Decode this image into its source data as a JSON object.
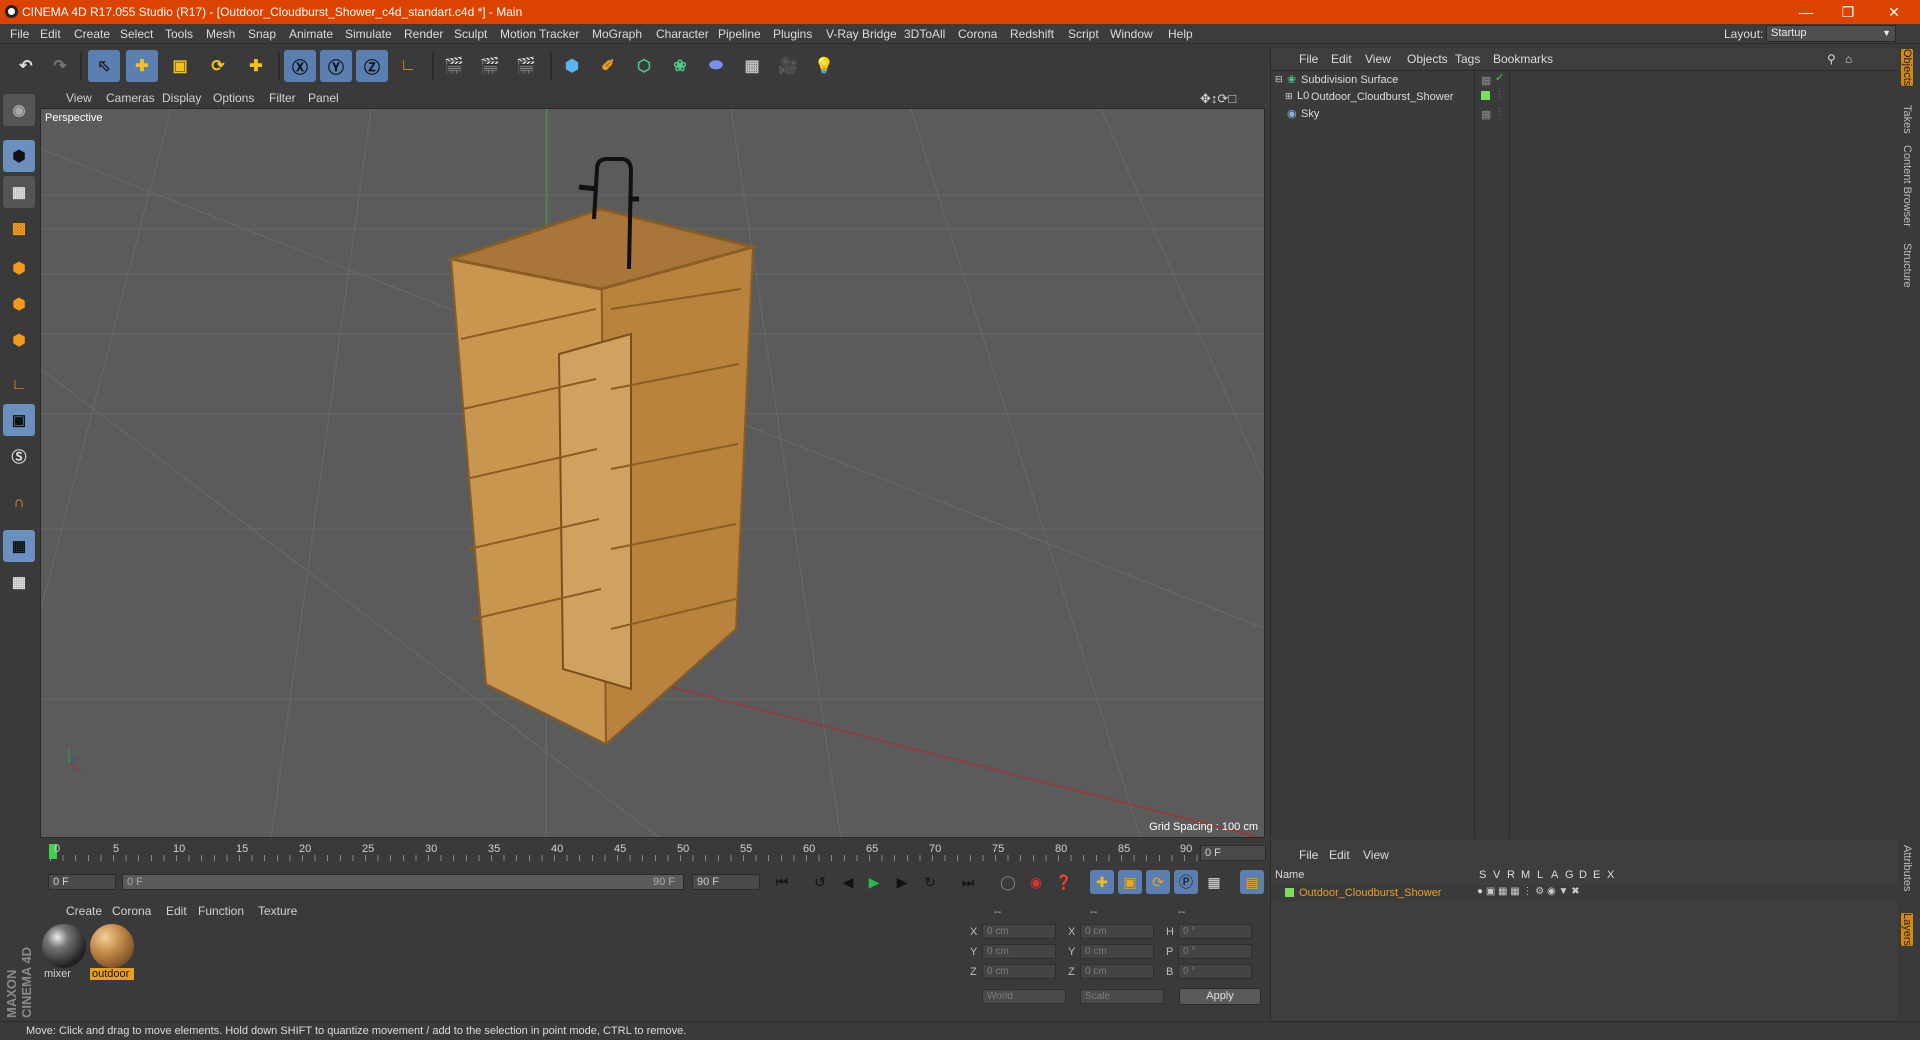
{
  "window": {
    "title": "CINEMA 4D R17.055 Studio (R17) - [Outdoor_Cloudburst_Shower_c4d_standart.c4d *] - Main"
  },
  "menu": [
    "File",
    "Edit",
    "Create",
    "Select",
    "Tools",
    "Mesh",
    "Snap",
    "Animate",
    "Simulate",
    "Render",
    "Sculpt",
    "Motion Tracker",
    "MoGraph",
    "Character",
    "Pipeline",
    "Plugins",
    "V-Ray Bridge",
    "3DToAll",
    "Corona",
    "Redshift",
    "Script",
    "Window",
    "Help"
  ],
  "layout": {
    "label": "Layout:",
    "value": "Startup"
  },
  "toolbar_icons": [
    "undo-icon",
    "redo-icon",
    "select-arrow-icon",
    "move-icon",
    "scale-icon",
    "rotate-icon",
    "add-icon",
    "x-axis-icon",
    "y-axis-icon",
    "z-axis-icon",
    "world-coordinate-icon",
    "render-view-icon",
    "render-region-icon",
    "render-manager-icon",
    "cube-icon",
    "pen-icon",
    "subdivision-icon",
    "cloner-icon",
    "deformer-icon",
    "floor-icon",
    "camera-icon",
    "light-icon"
  ],
  "viewport": {
    "menu": [
      "View",
      "Cameras",
      "Display",
      "Options",
      "Filter",
      "Panel"
    ],
    "label": "Perspective",
    "grid_spacing": "Grid Spacing : 100 cm"
  },
  "timeline": {
    "ticks": [
      "0",
      "5",
      "10",
      "15",
      "20",
      "25",
      "30",
      "35",
      "40",
      "45",
      "50",
      "55",
      "60",
      "65",
      "70",
      "75",
      "80",
      "85",
      "90"
    ],
    "frame_value": "0 F",
    "start_field": "0 F",
    "slider_left": "0 F",
    "slider_right": "90 F",
    "end_field": "90 F"
  },
  "materials": {
    "menu": [
      "Create",
      "Corona",
      "Edit",
      "Function",
      "Texture"
    ],
    "items": [
      {
        "name": "mixer"
      },
      {
        "name": "outdoor"
      }
    ]
  },
  "coords": {
    "header": [
      "--",
      "--",
      "--"
    ],
    "rows": [
      {
        "a": "X",
        "av": "0 cm",
        "b": "X",
        "bv": "0 cm",
        "c": "H",
        "cv": "0 °"
      },
      {
        "a": "Y",
        "av": "0 cm",
        "b": "Y",
        "bv": "0 cm",
        "c": "P",
        "cv": "0 °"
      },
      {
        "a": "Z",
        "av": "0 cm",
        "b": "Z",
        "bv": "0 cm",
        "c": "B",
        "cv": "0 °"
      }
    ],
    "world": "World",
    "scale": "Scale",
    "apply": "Apply"
  },
  "objects": {
    "menu": [
      "File",
      "Edit",
      "View",
      "Objects",
      "Tags",
      "Bookmarks"
    ],
    "items": [
      {
        "name": "Subdivision Surface"
      },
      {
        "name": "Outdoor_Cloudburst_Shower"
      },
      {
        "name": "Sky"
      }
    ]
  },
  "layers": {
    "menu": [
      "File",
      "Edit",
      "View"
    ],
    "header_name": "Name",
    "columns": [
      "S",
      "V",
      "R",
      "M",
      "L",
      "A",
      "G",
      "D",
      "E",
      "X"
    ],
    "item": "Outdoor_Cloudburst_Shower"
  },
  "right_tabs": [
    "Objects",
    "Takes",
    "Content Browser",
    "Structure",
    "Attributes",
    "Layers"
  ],
  "status": "Move: Click and drag to move elements. Hold down SHIFT to quantize movement / add to the selection in point mode, CTRL to remove.",
  "colors": {
    "accent": "#dd4300",
    "selection_blue": "#5a7fb0",
    "layer_orange": "#e8a01c"
  }
}
